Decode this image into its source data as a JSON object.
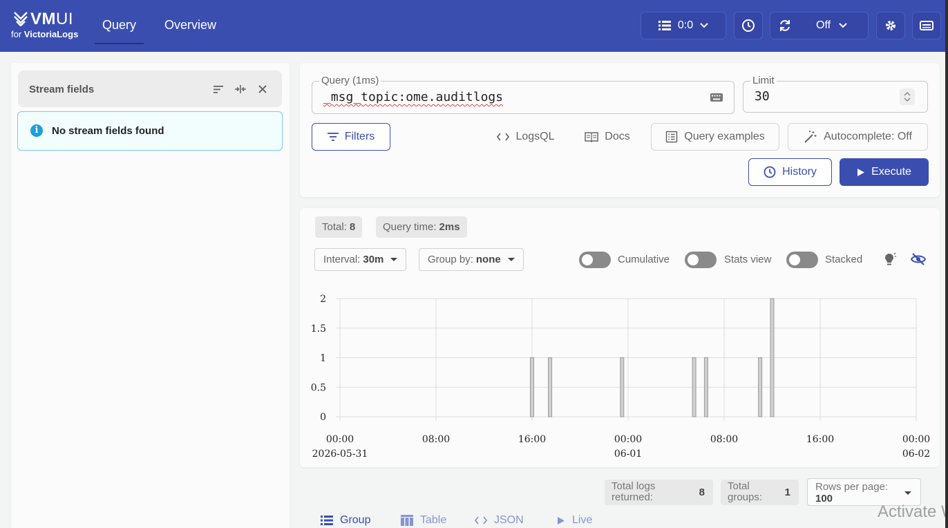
{
  "header": {
    "logo_vm": "VM",
    "logo_ui": "UI",
    "logo_for": "for ",
    "logo_brand": "VictoriaLogs",
    "tabs": [
      {
        "label": "Query"
      },
      {
        "label": "Overview"
      }
    ],
    "tenant": "0:0",
    "refresh": "Off"
  },
  "sidebar": {
    "title": "Stream fields",
    "info": "No stream fields found"
  },
  "query": {
    "label": "Query (1ms)",
    "value": "_msg_topic:ome.auditlogs",
    "limit_label": "Limit",
    "limit_value": "30",
    "filters": "Filters",
    "logsql": "LogsQL",
    "docs": "Docs",
    "examples": "Query examples",
    "autocomplete": "Autocomplete: Off",
    "history": "History",
    "execute": "Execute"
  },
  "stats": {
    "total_label": "Total:",
    "total_value": "8",
    "qtime_label": "Query time:",
    "qtime_value": "2ms",
    "interval_label": "Interval:",
    "interval_value": "30m",
    "groupby_label": "Group by:",
    "groupby_value": "none",
    "toggles": [
      "Cumulative",
      "Stats view",
      "Stacked"
    ]
  },
  "chart_data": {
    "type": "bar",
    "x_labels": [
      {
        "time": "00:00",
        "date": "2026-05-31"
      },
      {
        "time": "08:00",
        "date": ""
      },
      {
        "time": "16:00",
        "date": ""
      },
      {
        "time": "00:00",
        "date": "06-01"
      },
      {
        "time": "08:00",
        "date": ""
      },
      {
        "time": "16:00",
        "date": ""
      },
      {
        "time": "00:00",
        "date": "06-02"
      }
    ],
    "x_range_hours": [
      0,
      48
    ],
    "y_ticks": [
      "2",
      "1.5",
      "1",
      "0.5",
      "0"
    ],
    "ylim": [
      0,
      2
    ],
    "bars": [
      {
        "hour": 16.0,
        "value": 1
      },
      {
        "hour": 17.5,
        "value": 1
      },
      {
        "hour": 23.5,
        "value": 1
      },
      {
        "hour": 29.5,
        "value": 1
      },
      {
        "hour": 30.5,
        "value": 1
      },
      {
        "hour": 35.0,
        "value": 1
      },
      {
        "hour": 36.0,
        "value": 2
      }
    ],
    "grid": true,
    "colors": {
      "bar_fill": "#d0d0d0",
      "bar_stroke": "#9a9a9a",
      "grid": "#dddddd"
    }
  },
  "results": {
    "total_logs_line1": "Total logs",
    "total_logs_line2": "returned:",
    "total_logs_value": "8",
    "total_groups_line1": "Total",
    "total_groups_line2": "groups:",
    "total_groups_value": "1",
    "rows_label": "Rows per page:",
    "rows_value": "100",
    "views": [
      {
        "label": "Group"
      },
      {
        "label": "Table"
      },
      {
        "label": "JSON"
      },
      {
        "label": "Live"
      }
    ]
  },
  "watermark": "Activate W",
  "colors": {
    "brand": "#3a4eb0",
    "info": "#1a9fd9"
  }
}
